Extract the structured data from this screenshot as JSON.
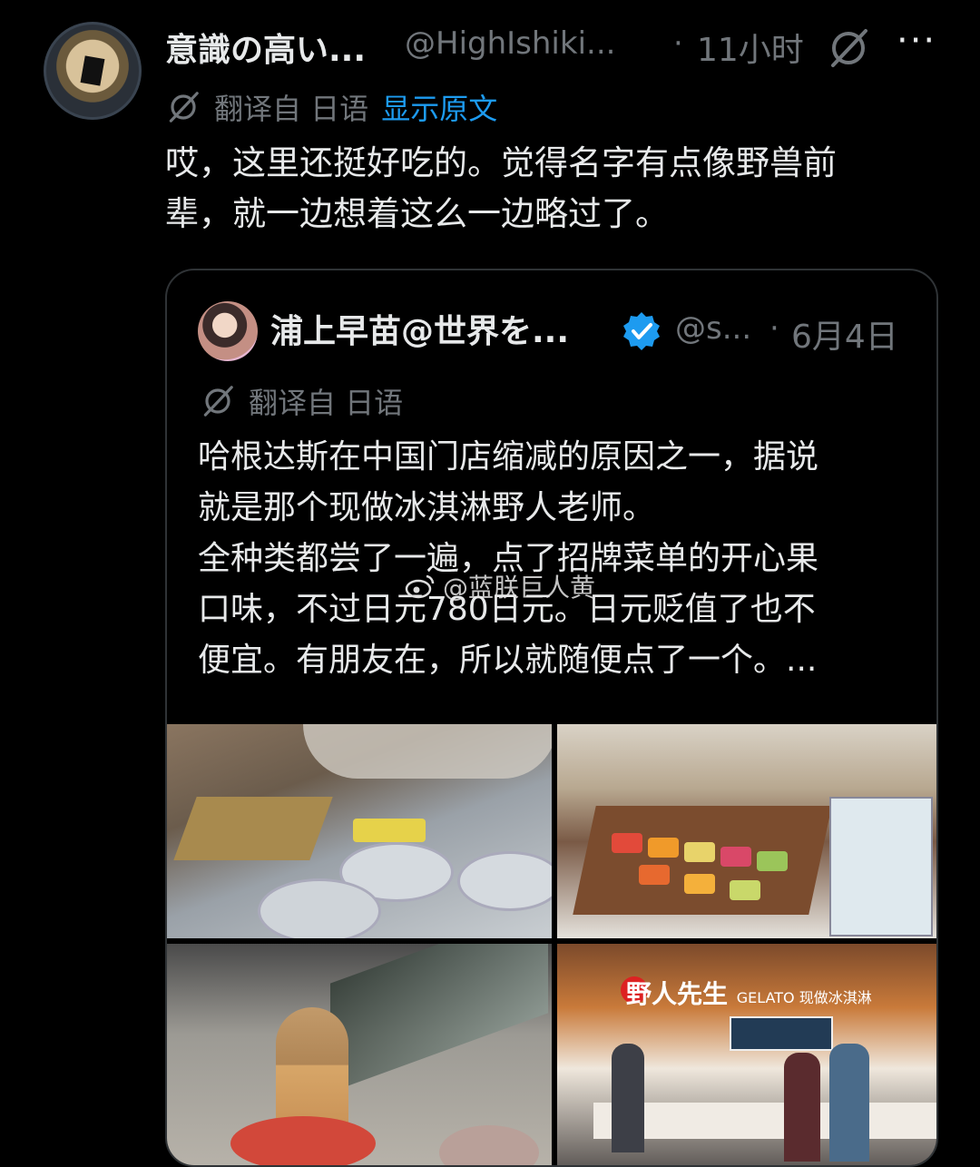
{
  "post": {
    "display_name": "意識の高い...",
    "handle": "@HighIshiki...",
    "separator": "·",
    "time": "11小时",
    "more": "···",
    "translated_from": "翻译自 日语",
    "show_original": "显示原文",
    "text_line1": "哎，这里还挺好吃的。觉得名字有点像野兽前",
    "text_line2": "辈，就一边想着这么一边略过了。"
  },
  "quote": {
    "display_name": "浦上早苗@世界を...",
    "handle": "@s...",
    "separator": "·",
    "date": "6月4日",
    "translated_from": "翻译自 日语",
    "text_line1": "哈根达斯在中国门店缩减的原因之一，据说",
    "text_line2": "就是那个现做冰淇淋野人老师。",
    "text_line3": "全种类都尝了一遍，点了招牌菜单的开心果",
    "text_line4": "口味，不过日元780日元。日元贬值了也不",
    "text_line5": "便宜。有朋友在，所以就随便点了一个。...",
    "watermark": "@蓝朕巨人黄"
  },
  "images": {
    "img4_sign": "野人先生",
    "img4_sign_sub": "GELATO 现做冰淇淋"
  },
  "colors": {
    "background": "#000000",
    "text": "#e7e9ea",
    "muted": "#71767b",
    "link": "#1d9bf0",
    "verified": "#1d9bf0",
    "border": "#2f3336"
  }
}
